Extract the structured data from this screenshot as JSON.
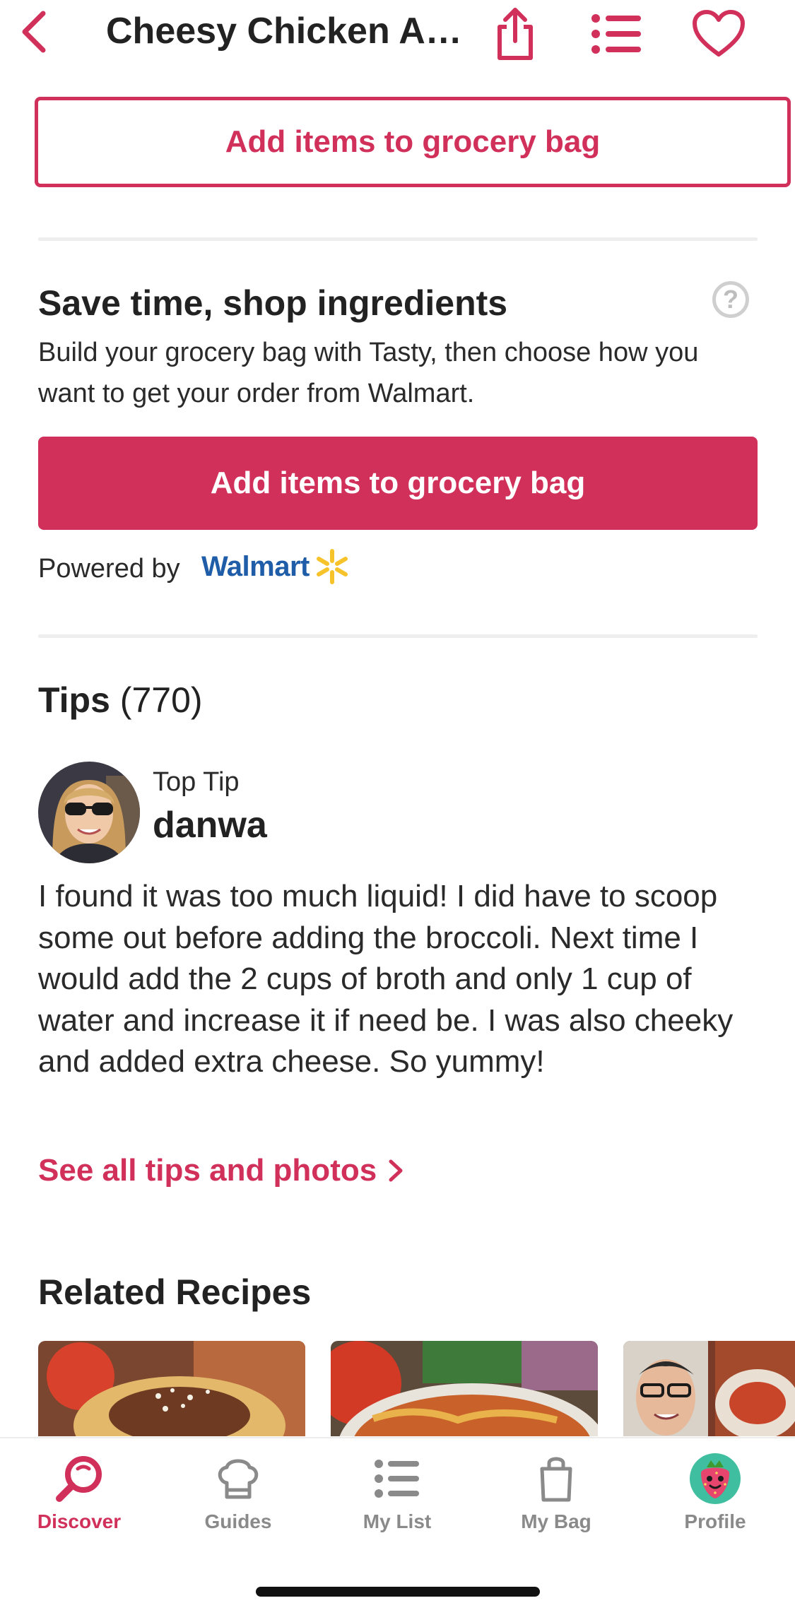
{
  "header": {
    "title": "Cheesy Chicken A…",
    "icons": [
      "chevron-left-icon",
      "share-icon",
      "list-icon",
      "heart-icon"
    ]
  },
  "grocery": {
    "outline_button_label": "Add items to grocery bag",
    "heading": "Save time, shop ingredients",
    "help_symbol": "?",
    "description": "Build your grocery bag with Tasty, then choose how you want to get your order from Walmart.",
    "fill_button_label": "Add items to grocery bag",
    "powered_by": "Powered by",
    "brand": "Walmart"
  },
  "tips": {
    "heading": "Tips",
    "count": "(770)",
    "top_tip_label": "Top Tip",
    "username": "danwa",
    "text": "I found it was too much liquid! I did have to scoop some out before adding the broccoli. Next time I would add the 2 cups of broth and only 1 cup of water and increase it if need be. I was also cheeky and added extra cheese. So yummy!",
    "see_all_label": "See all tips and photos"
  },
  "related": {
    "heading": "Related Recipes"
  },
  "tabbar": {
    "items": [
      {
        "label": "Discover",
        "icon": "search-icon",
        "active": true
      },
      {
        "label": "Guides",
        "icon": "chef-hat-icon",
        "active": false
      },
      {
        "label": "My List",
        "icon": "list-icon",
        "active": false
      },
      {
        "label": "My Bag",
        "icon": "bag-icon",
        "active": false
      },
      {
        "label": "Profile",
        "icon": "strawberry-avatar-icon",
        "active": false
      }
    ]
  },
  "colors": {
    "accent": "#d1305a",
    "walmart_blue": "#1f5da8",
    "walmart_yellow": "#f7c32b"
  }
}
